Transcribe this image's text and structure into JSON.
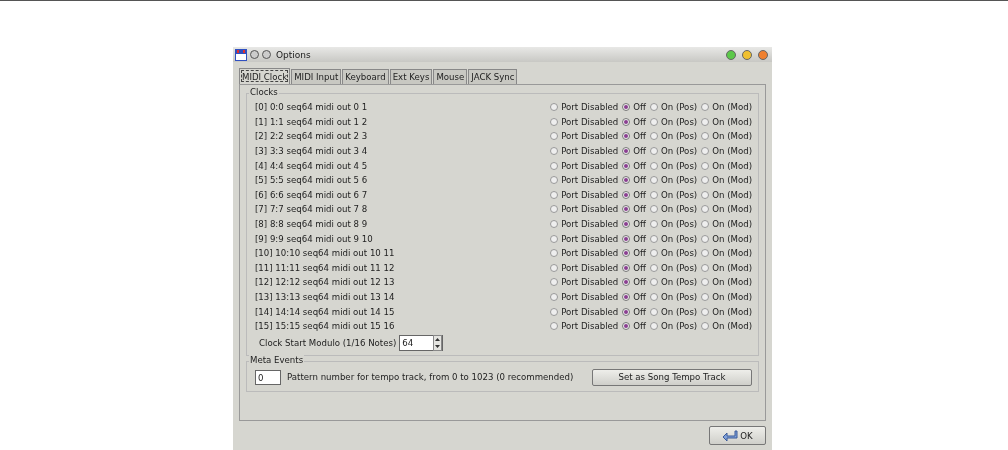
{
  "window": {
    "title": "Options"
  },
  "tabs": [
    {
      "label": "MIDI Clock",
      "selected": true
    },
    {
      "label": "MIDI Input",
      "selected": false
    },
    {
      "label": "Keyboard",
      "selected": false
    },
    {
      "label": "Ext Keys",
      "selected": false
    },
    {
      "label": "Mouse",
      "selected": false
    },
    {
      "label": "JACK Sync",
      "selected": false
    }
  ],
  "clocks": {
    "title": "Clocks",
    "rows": [
      {
        "label": "[0] 0:0 seq64 midi out 0 1",
        "options": [
          {
            "label": "Port Disabled",
            "selected": false
          },
          {
            "label": "Off",
            "selected": true
          },
          {
            "label": "On (Pos)",
            "selected": false
          },
          {
            "label": "On (Mod)",
            "selected": false
          }
        ]
      },
      {
        "label": "[1] 1:1 seq64 midi out 1 2",
        "options": [
          {
            "label": "Port Disabled",
            "selected": false
          },
          {
            "label": "Off",
            "selected": true
          },
          {
            "label": "On (Pos)",
            "selected": false
          },
          {
            "label": "On (Mod)",
            "selected": false
          }
        ]
      },
      {
        "label": "[2] 2:2 seq64 midi out 2 3",
        "options": [
          {
            "label": "Port Disabled",
            "selected": false
          },
          {
            "label": "Off",
            "selected": true
          },
          {
            "label": "On (Pos)",
            "selected": false
          },
          {
            "label": "On (Mod)",
            "selected": false
          }
        ]
      },
      {
        "label": "[3] 3:3 seq64 midi out 3 4",
        "options": [
          {
            "label": "Port Disabled",
            "selected": false
          },
          {
            "label": "Off",
            "selected": true
          },
          {
            "label": "On (Pos)",
            "selected": false
          },
          {
            "label": "On (Mod)",
            "selected": false
          }
        ]
      },
      {
        "label": "[4] 4:4 seq64 midi out 4 5",
        "options": [
          {
            "label": "Port Disabled",
            "selected": false
          },
          {
            "label": "Off",
            "selected": true
          },
          {
            "label": "On (Pos)",
            "selected": false
          },
          {
            "label": "On (Mod)",
            "selected": false
          }
        ]
      },
      {
        "label": "[5] 5:5 seq64 midi out 5 6",
        "options": [
          {
            "label": "Port Disabled",
            "selected": false
          },
          {
            "label": "Off",
            "selected": true
          },
          {
            "label": "On (Pos)",
            "selected": false
          },
          {
            "label": "On (Mod)",
            "selected": false
          }
        ]
      },
      {
        "label": "[6] 6:6 seq64 midi out 6 7",
        "options": [
          {
            "label": "Port Disabled",
            "selected": false
          },
          {
            "label": "Off",
            "selected": true
          },
          {
            "label": "On (Pos)",
            "selected": false
          },
          {
            "label": "On (Mod)",
            "selected": false
          }
        ]
      },
      {
        "label": "[7] 7:7 seq64 midi out 7 8",
        "options": [
          {
            "label": "Port Disabled",
            "selected": false
          },
          {
            "label": "Off",
            "selected": true
          },
          {
            "label": "On (Pos)",
            "selected": false
          },
          {
            "label": "On (Mod)",
            "selected": false
          }
        ]
      },
      {
        "label": "[8] 8:8 seq64 midi out 8 9",
        "options": [
          {
            "label": "Port Disabled",
            "selected": false
          },
          {
            "label": "Off",
            "selected": true
          },
          {
            "label": "On (Pos)",
            "selected": false
          },
          {
            "label": "On (Mod)",
            "selected": false
          }
        ]
      },
      {
        "label": "[9] 9:9 seq64 midi out 9 10",
        "options": [
          {
            "label": "Port Disabled",
            "selected": false
          },
          {
            "label": "Off",
            "selected": true
          },
          {
            "label": "On (Pos)",
            "selected": false
          },
          {
            "label": "On (Mod)",
            "selected": false
          }
        ]
      },
      {
        "label": "[10] 10:10 seq64 midi out 10 11",
        "options": [
          {
            "label": "Port Disabled",
            "selected": false
          },
          {
            "label": "Off",
            "selected": true
          },
          {
            "label": "On (Pos)",
            "selected": false
          },
          {
            "label": "On (Mod)",
            "selected": false
          }
        ]
      },
      {
        "label": "[11] 11:11 seq64 midi out 11 12",
        "options": [
          {
            "label": "Port Disabled",
            "selected": false
          },
          {
            "label": "Off",
            "selected": true
          },
          {
            "label": "On (Pos)",
            "selected": false
          },
          {
            "label": "On (Mod)",
            "selected": false
          }
        ]
      },
      {
        "label": "[12] 12:12 seq64 midi out 12 13",
        "options": [
          {
            "label": "Port Disabled",
            "selected": false
          },
          {
            "label": "Off",
            "selected": true
          },
          {
            "label": "On (Pos)",
            "selected": false
          },
          {
            "label": "On (Mod)",
            "selected": false
          }
        ]
      },
      {
        "label": "[13] 13:13 seq64 midi out 13 14",
        "options": [
          {
            "label": "Port Disabled",
            "selected": false
          },
          {
            "label": "Off",
            "selected": true
          },
          {
            "label": "On (Pos)",
            "selected": false
          },
          {
            "label": "On (Mod)",
            "selected": false
          }
        ]
      },
      {
        "label": "[14] 14:14 seq64 midi out 14 15",
        "options": [
          {
            "label": "Port Disabled",
            "selected": false
          },
          {
            "label": "Off",
            "selected": true
          },
          {
            "label": "On (Pos)",
            "selected": false
          },
          {
            "label": "On (Mod)",
            "selected": false
          }
        ]
      },
      {
        "label": "[15] 15:15 seq64 midi out 15 16",
        "options": [
          {
            "label": "Port Disabled",
            "selected": false
          },
          {
            "label": "Off",
            "selected": true
          },
          {
            "label": "On (Pos)",
            "selected": false
          },
          {
            "label": "On (Mod)",
            "selected": false
          }
        ]
      }
    ],
    "modulo": {
      "label": "Clock Start Modulo (1/16 Notes)",
      "value": "64"
    }
  },
  "meta_events": {
    "title": "Meta Events",
    "value": "0",
    "description": "Pattern number for tempo track, from 0 to 1023 (0 recommended)",
    "button": "Set as Song Tempo Track"
  },
  "ok_button": "OK"
}
